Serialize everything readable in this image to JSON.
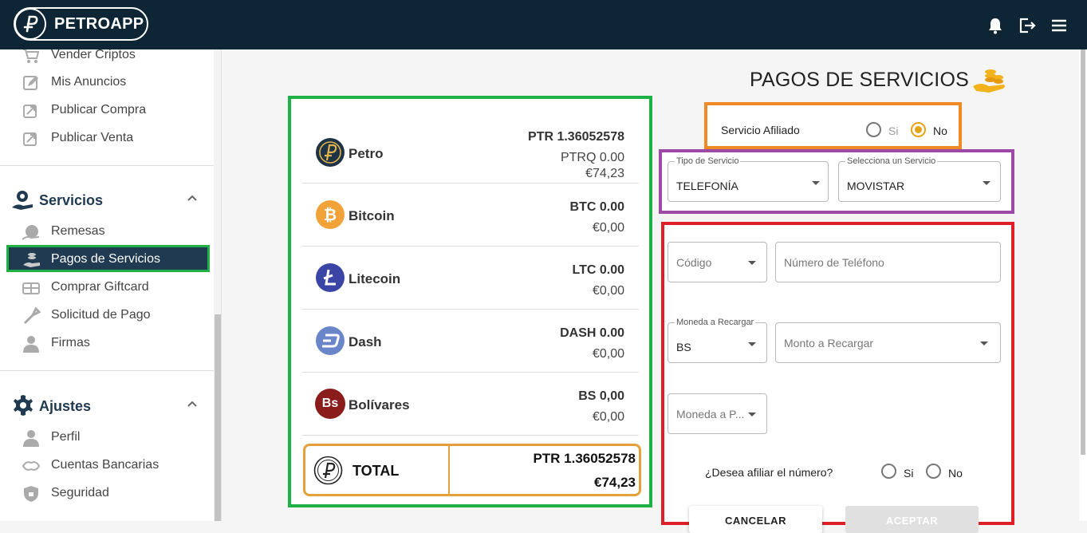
{
  "header": {
    "brand": "PETROAPP",
    "icons": [
      "bell-icon",
      "logout-icon",
      "menu-icon"
    ]
  },
  "sidebar": {
    "items_top": [
      {
        "label": "Vender Criptos",
        "icon": "cart-icon"
      },
      {
        "label": "Mis Anuncios",
        "icon": "edit-icon"
      },
      {
        "label": "Publicar Compra",
        "icon": "publish-buy-icon"
      },
      {
        "label": "Publicar Venta",
        "icon": "publish-sell-icon"
      }
    ],
    "services_section": {
      "title": "Servicios",
      "items": [
        {
          "label": "Remesas",
          "icon": "remesas-icon"
        },
        {
          "label": "Pagos de Servicios",
          "icon": "pagos-icon",
          "active": true
        },
        {
          "label": "Comprar Giftcard",
          "icon": "giftcard-icon"
        },
        {
          "label": "Solicitud de Pago",
          "icon": "solicitud-icon"
        },
        {
          "label": "Firmas",
          "icon": "user-icon"
        }
      ]
    },
    "settings_section": {
      "title": "Ajustes",
      "items": [
        {
          "label": "Perfil",
          "icon": "user-icon"
        },
        {
          "label": "Cuentas Bancarias",
          "icon": "bank-icon"
        },
        {
          "label": "Seguridad",
          "icon": "shield-icon"
        }
      ]
    }
  },
  "page": {
    "title": "PAGOS DE SERVICIOS"
  },
  "wallet": {
    "coins": [
      {
        "name": "Petro",
        "amount": "PTR 1.36052578",
        "sub1": "PTRQ 0.00",
        "sub2": "€74,23"
      },
      {
        "name": "Bitcoin",
        "amount": "BTC 0.00",
        "sub1": "€0,00"
      },
      {
        "name": "Litecoin",
        "amount": "LTC 0.00",
        "sub1": "€0,00"
      },
      {
        "name": "Dash",
        "amount": "DASH 0.00",
        "sub1": "€0,00"
      },
      {
        "name": "Bolívares",
        "amount": "BS 0,00",
        "sub1": "€0,00"
      }
    ],
    "bs_icon_text": "Bs",
    "total": {
      "label": "TOTAL",
      "ptr": "PTR 1.36052578",
      "eur": "€74,23"
    }
  },
  "afiliado": {
    "label": "Servicio Afiliado",
    "yes": "Si",
    "no": "No",
    "selected": "No"
  },
  "service": {
    "tipo_label": "Tipo de Servicio",
    "tipo_value": "TELEFONÍA",
    "servicio_label": "Selecciona un Servicio",
    "servicio_value": "MOVISTAR"
  },
  "form": {
    "codigo_placeholder": "Código",
    "telefono_placeholder": "Número de Teléfono",
    "moneda_label": "Moneda a Recargar",
    "moneda_value": "BS",
    "monto_placeholder": "Monto a Recargar",
    "moneda_pago_placeholder": "Moneda a P...",
    "afiliar_question": "¿Desea afiliar el número?",
    "afiliar_yes": "Si",
    "afiliar_no": "No"
  },
  "buttons": {
    "cancel": "CANCELAR",
    "ok": "ACEPTAR"
  },
  "colors": {
    "header_bg": "#0d2534",
    "active_bg": "#203a51",
    "green_border": "#1db146",
    "orange_border": "#f08a24",
    "purple_border": "#9d4aa6",
    "red_border": "#de2027",
    "gold": "#e4a03a"
  }
}
